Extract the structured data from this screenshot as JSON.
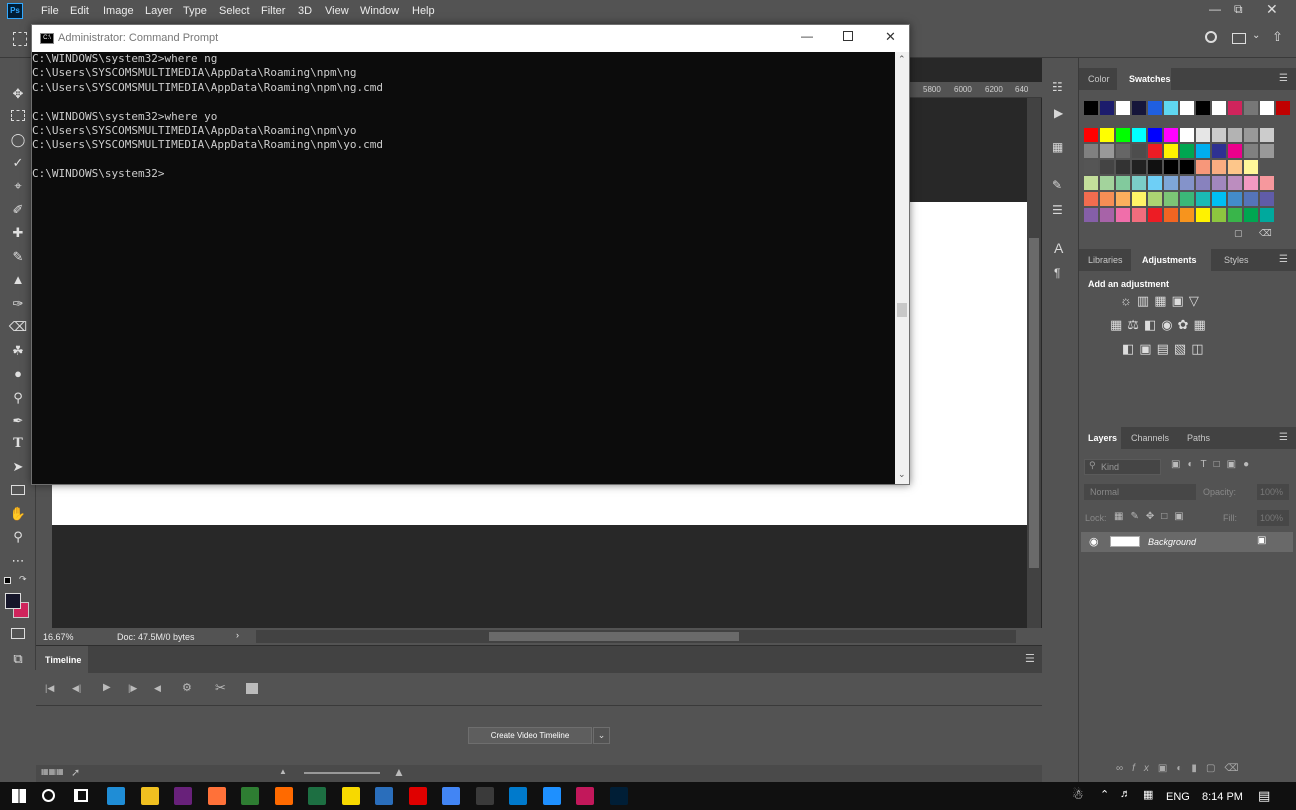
{
  "photoshop": {
    "app_icon": "Ps",
    "menu": [
      "File",
      "Edit",
      "Image",
      "Layer",
      "Type",
      "Select",
      "Filter",
      "3D",
      "View",
      "Window",
      "Help"
    ],
    "ruler_ticks": [
      "5800",
      "6000",
      "6200",
      "640"
    ],
    "status": {
      "zoom": "16.67%",
      "doc": "Doc: 47.5M/0 bytes"
    },
    "timeline": {
      "title": "Timeline",
      "create_button": "Create Video Timeline"
    },
    "swatch_panel": {
      "tabs": [
        "Color",
        "Swatches"
      ],
      "active": "Swatches"
    },
    "adjust_panel": {
      "tabs": [
        "Libraries",
        "Adjustments",
        "Styles"
      ],
      "active": "Adjustments",
      "heading": "Add an adjustment"
    },
    "layers_panel": {
      "tabs": [
        "Layers",
        "Channels",
        "Paths"
      ],
      "active": "Layers",
      "kind_placeholder": "Kind",
      "blend_mode": "Normal",
      "opacity_label": "Opacity:",
      "opacity_value": "100%",
      "lock_label": "Lock:",
      "fill_label": "Fill:",
      "fill_value": "100%",
      "layer_name": "Background"
    },
    "swatch_colors": [
      [
        "#000000",
        "#1c1c6c",
        "#ffffff",
        "#16163a",
        "#1f5fe0",
        "#5fd7f0",
        "#ffffff",
        "#000000",
        "#ffffff",
        "#d0245c",
        "#777777",
        "#ffffff",
        "#c00000"
      ],
      [
        "#ff0000",
        "#ffff00",
        "#00ff00",
        "#00ffff",
        "#0000ff",
        "#ff00ff",
        "#ffffff",
        "#e6e6e6",
        "#cccccc",
        "#b3b3b3",
        "#999999",
        "#cccccc"
      ],
      [
        "#808080",
        "#999999",
        "#666666",
        "#4d4d4d",
        "#ed1c24",
        "#fff200",
        "#00a651",
        "#00aeef",
        "#2e3192",
        "#ec008c",
        "#808080",
        "#999999"
      ],
      [
        "#555555",
        "#444444",
        "#333333",
        "#222222",
        "#111111",
        "#000000",
        "#000000",
        "#f7977a",
        "#f9ad81",
        "#fdc68a",
        "#fff79a"
      ],
      [
        "#c4df9b",
        "#a3d39c",
        "#82ca9d",
        "#7bcdc8",
        "#6ecff6",
        "#7ea7d8",
        "#8493ca",
        "#8882be",
        "#a187be",
        "#bc8dbf",
        "#f49ac2",
        "#f6989d"
      ],
      [
        "#f26c4f",
        "#f68e55",
        "#fbaf5d",
        "#fff467",
        "#acd372",
        "#7cc576",
        "#3bb878",
        "#1abbb4",
        "#00bff3",
        "#438cca",
        "#5574b9",
        "#605ca8"
      ],
      [
        "#855fa8",
        "#a763a8",
        "#f06eaa",
        "#f26d7d",
        "#ed1c24",
        "#f26522",
        "#f7941d",
        "#fff200",
        "#8dc63f",
        "#39b54a",
        "#00a651",
        "#00a99d"
      ]
    ]
  },
  "cmd": {
    "title": "Administrator: Command Prompt",
    "lines": [
      "C:\\WINDOWS\\system32>where ng",
      "C:\\Users\\SYSCOMSMULTIMEDIA\\AppData\\Roaming\\npm\\ng",
      "C:\\Users\\SYSCOMSMULTIMEDIA\\AppData\\Roaming\\npm\\ng.cmd",
      "",
      "C:\\WINDOWS\\system32>where yo",
      "C:\\Users\\SYSCOMSMULTIMEDIA\\AppData\\Roaming\\npm\\yo",
      "C:\\Users\\SYSCOMSMULTIMEDIA\\AppData\\Roaming\\npm\\yo.cmd",
      "",
      "C:\\WINDOWS\\system32>"
    ]
  },
  "taskbar": {
    "lang": "ENG",
    "time": "8:14 PM",
    "apps": [
      "#1f8dd6",
      "#f0c020",
      "#68217a",
      "#ff7139",
      "#2e7d32",
      "#ff6a00",
      "#1d6f42",
      "#f7d900",
      "#2a6ebb",
      "#e00000",
      "#4285f4",
      "#3a3a3a",
      "#007acc",
      "#1e90ff",
      "#c2185b",
      "#001e36"
    ]
  }
}
